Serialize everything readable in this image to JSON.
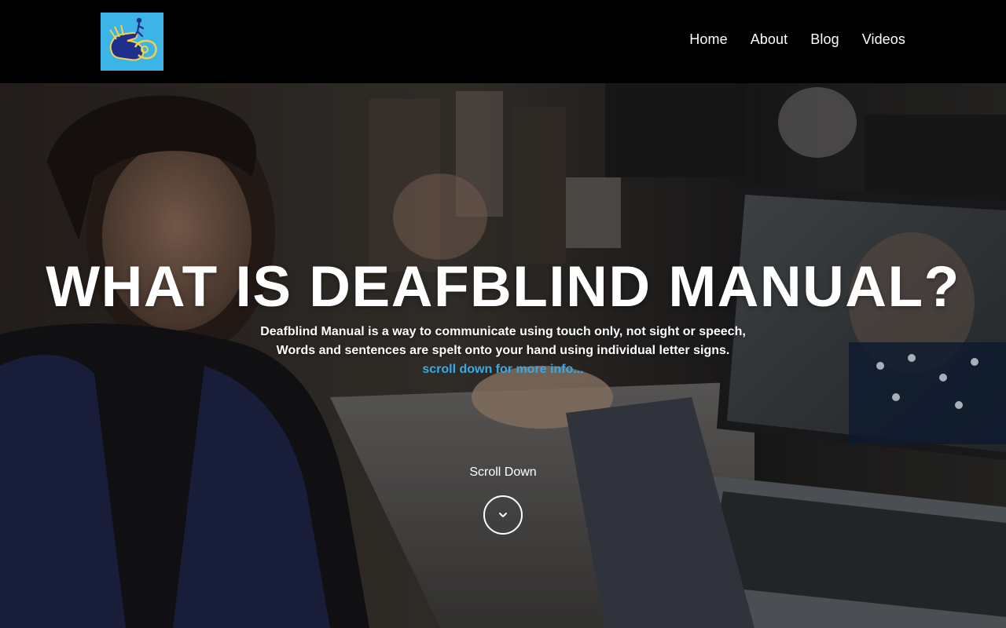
{
  "header": {
    "logo_icon": "fingerspelling-hands-logo-icon",
    "nav": [
      {
        "label": "Home"
      },
      {
        "label": "About"
      },
      {
        "label": "Blog"
      },
      {
        "label": "Videos"
      }
    ]
  },
  "hero": {
    "title": "WHAT IS DEAFBLIND MANUAL?",
    "description_lines": [
      "Deafblind Manual is a way to communicate using touch only, not sight or speech,",
      "Words and sentences are spelt onto your hand using individual letter signs."
    ],
    "more_info_link": "scroll down for more info...",
    "scroll_label": "Scroll Down",
    "scroll_icon": "chevron-down-icon"
  },
  "colors": {
    "header_bg": "#000000",
    "logo_bg": "#3db4e8",
    "link_accent": "#3aa9e6",
    "text": "#ffffff"
  }
}
